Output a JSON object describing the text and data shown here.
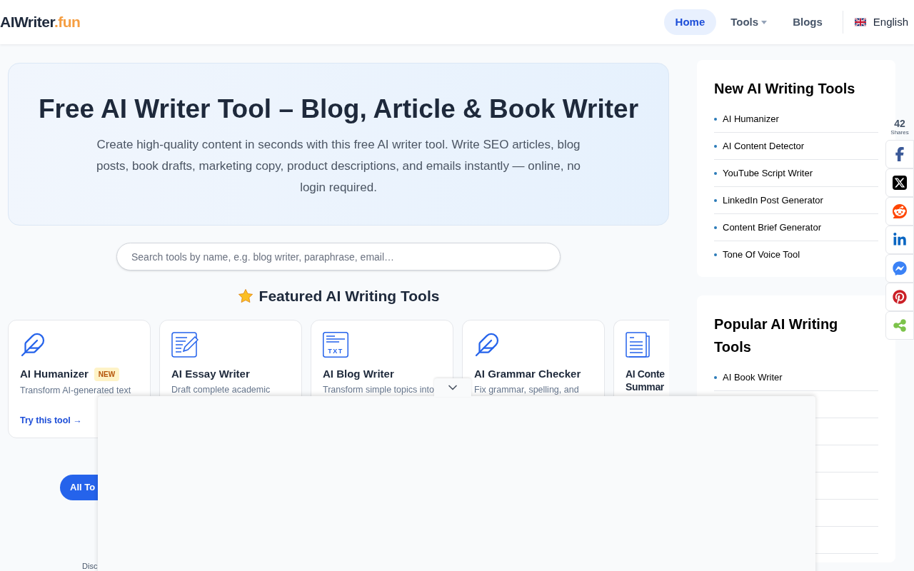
{
  "header": {
    "logo": {
      "name": "AIWriter",
      "suffix": ".fun"
    },
    "nav": [
      {
        "label": "Home",
        "selected": true,
        "kind": "link"
      },
      {
        "label": "Tools",
        "selected": false,
        "kind": "dropdown"
      },
      {
        "label": "Blogs",
        "selected": false,
        "kind": "link"
      }
    ],
    "language": "English"
  },
  "hero": {
    "title": "Free AI Writer Tool – Blog, Article & Book Writer",
    "subtitle": "Create high-quality content in seconds with this free AI writer tool. Write SEO articles, blog posts, book drafts, marketing copy, product descriptions, and emails instantly — online, no login required."
  },
  "search": {
    "placeholder": "Search tools by name, e.g. blog writer, paraphrase, email…"
  },
  "featured": {
    "title": "Featured AI Writing Tools",
    "cards": [
      {
        "kind": "feather",
        "title": "AI Humanizer",
        "badge": "NEW",
        "description": "Transform AI-generated text",
        "link": "Try this tool →"
      },
      {
        "kind": "essay",
        "title": "AI Essay Writer",
        "description": "Draft complete academic"
      },
      {
        "kind": "txt",
        "icon_text": "TXT",
        "title": "AI Blog Writer",
        "description": "Transform simple topics into"
      },
      {
        "kind": "feather",
        "title": "AI Grammar Checker",
        "description": "Fix grammar, spelling, and"
      },
      {
        "kind": "document",
        "title": "AI Conte Summar"
      }
    ]
  },
  "all_tools_button": "All To",
  "footer_text": "Disc",
  "sidebar": {
    "new_tools": {
      "title": "New AI Writing Tools",
      "items": [
        "AI Humanizer",
        "AI Content Detector",
        "YouTube Script Writer",
        "LinkedIn Post Generator",
        "Content Brief Generator",
        "Tone Of Voice Tool"
      ]
    },
    "popular_tools": {
      "title": "Popular AI Writing Tools",
      "items": [
        "AI Book Writer"
      ]
    }
  },
  "share": {
    "count": "42",
    "label": "Shares",
    "buttons": [
      {
        "kind": "facebook"
      },
      {
        "kind": "x"
      },
      {
        "kind": "reddit"
      },
      {
        "kind": "linkedin"
      },
      {
        "kind": "messenger"
      },
      {
        "kind": "pinterest"
      },
      {
        "kind": "share"
      }
    ]
  }
}
